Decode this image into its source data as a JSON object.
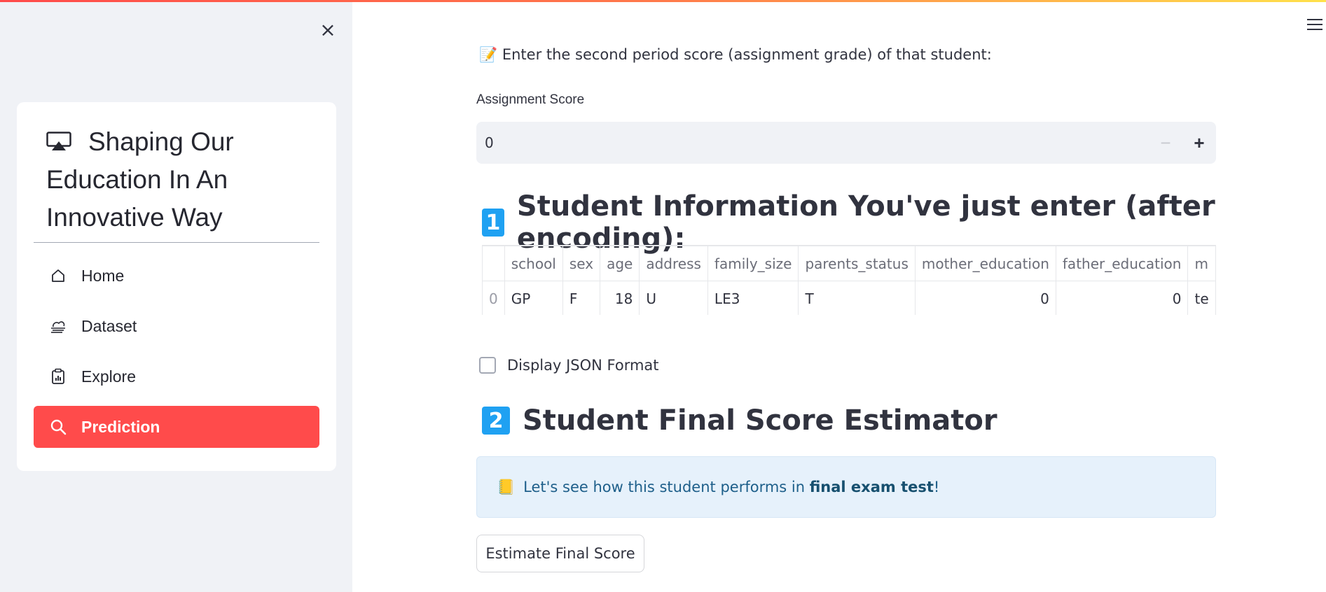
{
  "sidebar": {
    "close_label": "×",
    "menu_title": "Shaping Our Education In An Innovative Way",
    "items": [
      {
        "label": "Home",
        "icon": "house-icon"
      },
      {
        "label": "Dataset",
        "icon": "cloud-haze-icon"
      },
      {
        "label": "Explore",
        "icon": "clipboard-data-icon"
      },
      {
        "label": "Prediction",
        "icon": "search-icon"
      }
    ],
    "active_item": "Prediction"
  },
  "main": {
    "prompt_emoji": "📝",
    "prompt_text": "Enter the second period score (assignment grade) of that student:",
    "assignment_label": "Assignment Score",
    "assignment_value": "0",
    "minus_label": "−",
    "plus_label": "+",
    "section1": {
      "badge": "1",
      "title": "Student Information You've just enter (after encoding):"
    },
    "table": {
      "headers": [
        "",
        "school",
        "sex",
        "age",
        "address",
        "family_size",
        "parents_status",
        "mother_education",
        "father_education",
        "m"
      ],
      "rows": [
        [
          "0",
          "GP",
          "F",
          "18",
          "U",
          "LE3",
          "T",
          "0",
          "0",
          "te"
        ]
      ]
    },
    "checkbox_label": "Display JSON Format",
    "section2": {
      "badge": "2",
      "title": "Student Final Score Estimator"
    },
    "info": {
      "emoji": "📒",
      "prefix": "Let's see how this student performs in ",
      "bold": "final exam test",
      "suffix": "!"
    },
    "button_label": "Estimate Final Score"
  },
  "colors": {
    "accent": "#ff4b4b",
    "badge": "#1fa1f2",
    "info_bg": "#e6f1fb"
  }
}
